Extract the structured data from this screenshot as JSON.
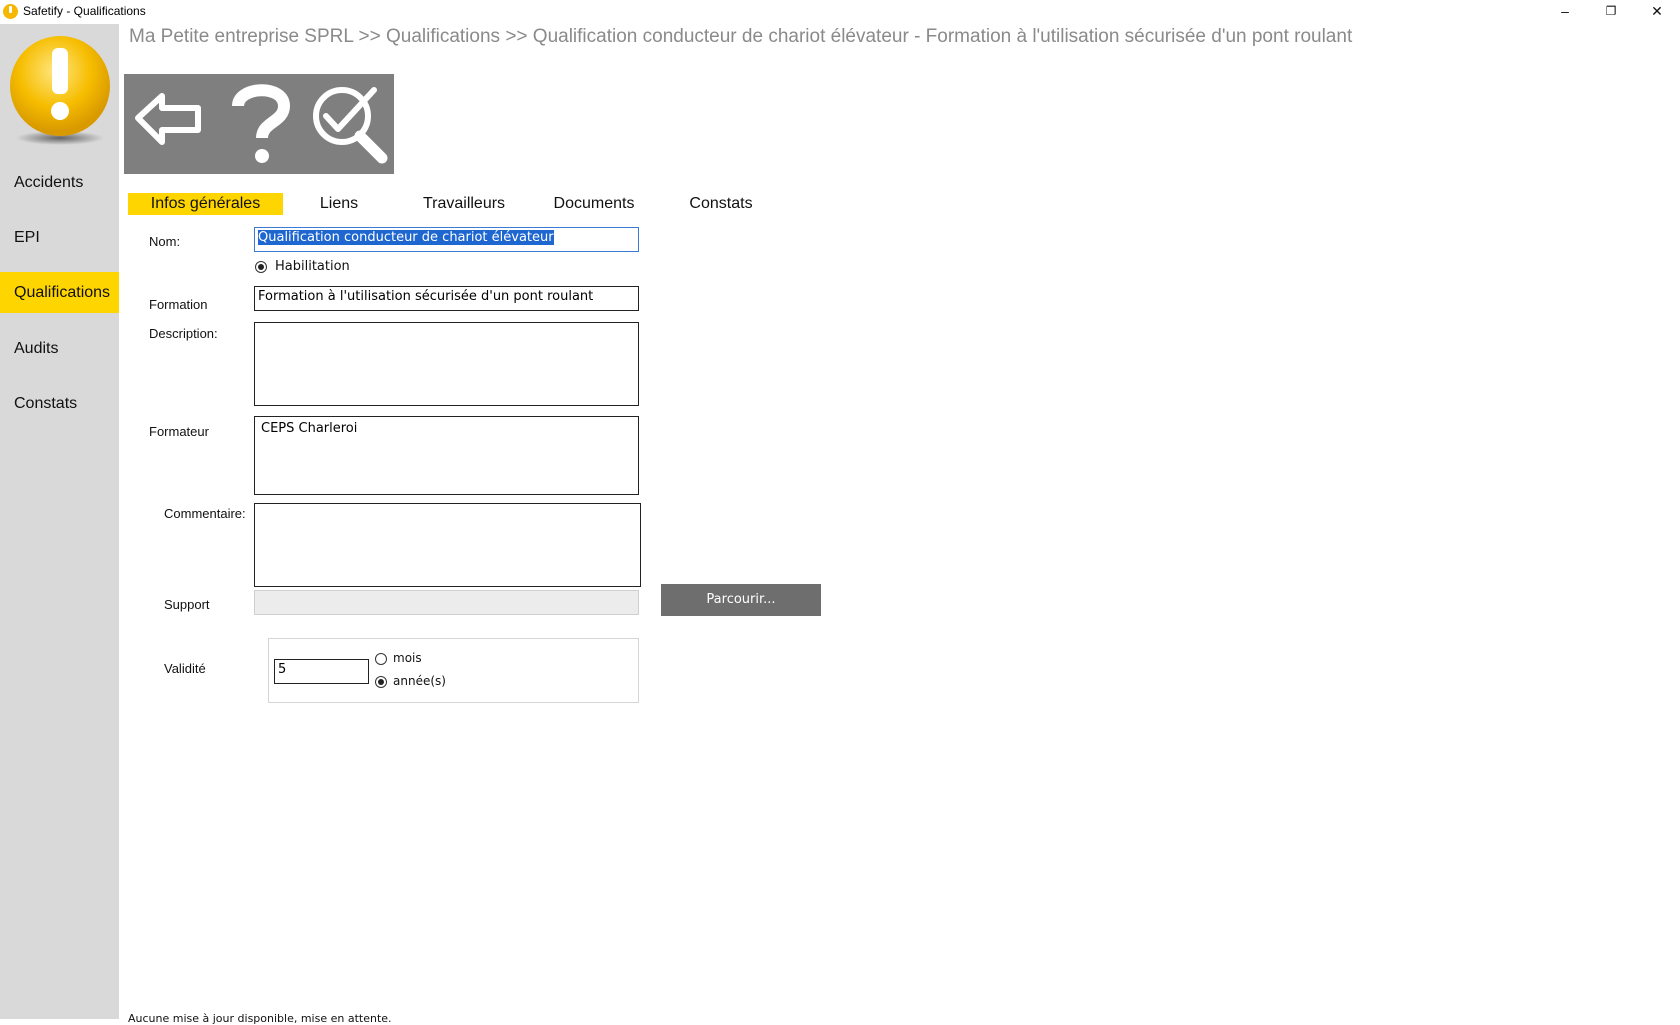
{
  "window": {
    "title": "Safetify - Qualifications",
    "minimize": "–",
    "restore": "❐",
    "close": "✕"
  },
  "sidebar": {
    "items": [
      {
        "label": "Accidents"
      },
      {
        "label": "EPI"
      },
      {
        "label": "Qualifications",
        "active": true
      },
      {
        "label": "Audits"
      },
      {
        "label": "Constats"
      }
    ]
  },
  "breadcrumb": "Ma Petite entreprise SPRL >> Qualifications >> Qualification conducteur de chariot élévateur - Formation à l'utilisation sécurisée d'un pont roulant",
  "toolbar": {
    "icons": [
      "back-arrow-icon",
      "help-question-icon",
      "search-check-icon"
    ]
  },
  "tabs": [
    {
      "label": "Infos générales",
      "active": true
    },
    {
      "label": "Liens"
    },
    {
      "label": "Travailleurs"
    },
    {
      "label": "Documents"
    },
    {
      "label": "Constats"
    }
  ],
  "form": {
    "nom_label": "Nom:",
    "nom_value": "Qualification conducteur de chariot élévateur",
    "habilitation_label": "Habilitation",
    "formation_label": "Formation",
    "formation_value": "Formation à l'utilisation sécurisée d'un pont roulant",
    "description_label": "Description:",
    "description_value": "",
    "formateur_label": "Formateur",
    "formateur_value": "CEPS Charleroi",
    "commentaire_label": "Commentaire:",
    "commentaire_value": "",
    "support_label": "Support",
    "support_value": "",
    "browse_label": "Parcourir...",
    "validite_label": "Validité",
    "validite_value": "5",
    "unit_options": [
      "mois",
      "année(s)"
    ],
    "unit_selected": "année(s)"
  },
  "status": "Aucune mise à jour disponible, mise en attente.",
  "colors": {
    "accent": "#ffd500",
    "sidebar": "#d9d9d9",
    "toolbar": "#7f7f7f",
    "breadcrumb": "#8a8a8a"
  }
}
